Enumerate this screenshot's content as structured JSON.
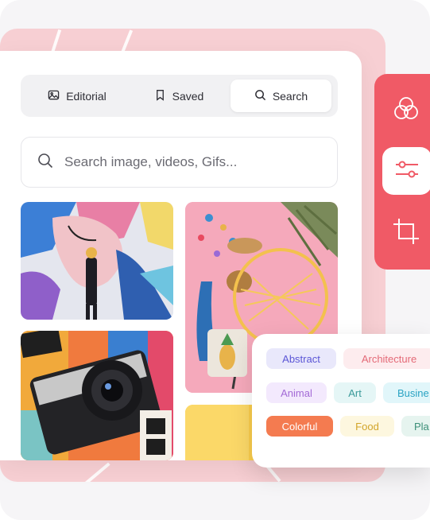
{
  "tabs": [
    {
      "label": "Editorial",
      "icon": "image-icon",
      "active": false
    },
    {
      "label": "Saved",
      "icon": "bookmark-icon",
      "active": false
    },
    {
      "label": "Search",
      "icon": "search-icon",
      "active": true
    }
  ],
  "search": {
    "placeholder": "Search image, videos, Gifs..."
  },
  "photos": [
    {
      "name": "street-art-mural-photo"
    },
    {
      "name": "hanging-chair-pink-wall-photo"
    },
    {
      "name": "vintage-camera-photo"
    },
    {
      "name": "yellow-backdrop-photo"
    }
  ],
  "tools": [
    {
      "name": "color-filter-icon",
      "active": false
    },
    {
      "name": "adjustments-sliders-icon",
      "active": true
    },
    {
      "name": "crop-icon",
      "active": false
    }
  ],
  "tags": [
    {
      "label": "Abstract",
      "bg": "#e9e8fb",
      "color": "#5b56d6"
    },
    {
      "label": "Architecture",
      "bg": "#fdecee",
      "color": "#e46a77"
    },
    {
      "label": "Animal",
      "bg": "#f3e9fd",
      "color": "#a36ad6"
    },
    {
      "label": "Art",
      "bg": "#e5f6f6",
      "color": "#3a9a9a"
    },
    {
      "label": "Busine",
      "bg": "#e1f6fa",
      "color": "#2aa3c3"
    },
    {
      "label": "Colorful",
      "bg": "#f47b50",
      "color": "#ffffff"
    },
    {
      "label": "Food",
      "bg": "#fdf7df",
      "color": "#d2a52a"
    },
    {
      "label": "Pla",
      "bg": "#e6f4ef",
      "color": "#3c8f78"
    }
  ],
  "colors": {
    "accent": "#f05a66",
    "backdrop": "#f7cfd3"
  }
}
